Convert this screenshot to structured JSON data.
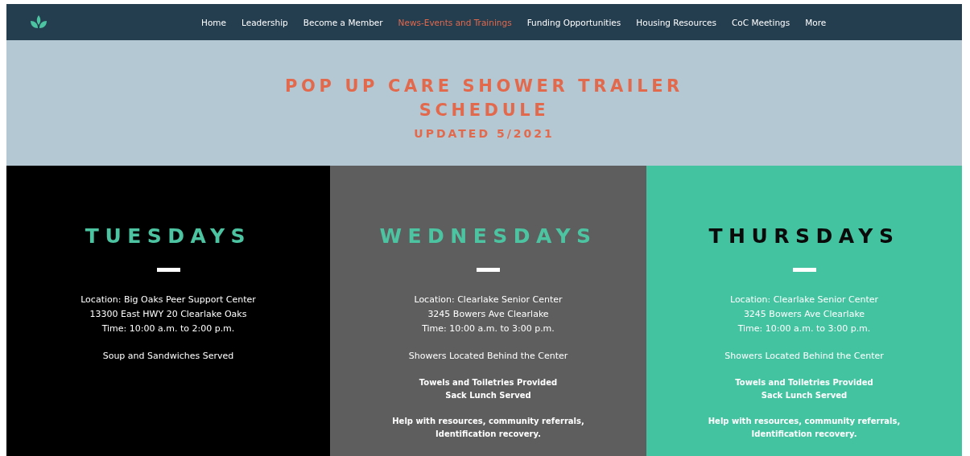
{
  "nav": {
    "items": [
      {
        "label": "Home",
        "selected": false
      },
      {
        "label": "Leadership",
        "selected": false
      },
      {
        "label": "Become a Member",
        "selected": false
      },
      {
        "label": "News-Events and Trainings",
        "selected": true
      },
      {
        "label": "Funding Opportunities",
        "selected": false
      },
      {
        "label": "Housing Resources",
        "selected": false
      },
      {
        "label": "CoC Meetings",
        "selected": false
      },
      {
        "label": "More",
        "selected": false
      }
    ]
  },
  "banner": {
    "title": "POP UP CARE SHOWER TRAILER SCHEDULE",
    "subtitle": "UPDATED 5/2021"
  },
  "columns": [
    {
      "kind": "dark",
      "day": "TUESDAYS",
      "paragraphs": [
        {
          "kind": "plain",
          "lines": [
            "Location: Big Oaks Peer Support Center",
            "13300 East HWY 20 Clearlake Oaks",
            "Time: 10:00 a.m. to 2:00 p.m."
          ]
        },
        {
          "kind": "plain",
          "lines": [
            "Soup and Sandwiches Served"
          ]
        }
      ]
    },
    {
      "kind": "gray",
      "day": "WEDNESDAYS",
      "paragraphs": [
        {
          "kind": "plain",
          "lines": [
            "Location: Clearlake Senior Center",
            "3245 Bowers Ave Clearlake",
            "Time: 10:00 a.m. to 3:00 p.m."
          ]
        },
        {
          "kind": "plain",
          "lines": [
            "Showers Located Behind the Center"
          ]
        },
        {
          "kind": "note",
          "lines": [
            "Towels and Toiletries Provided",
            "Sack Lunch Served"
          ]
        },
        {
          "kind": "note",
          "lines": [
            "Help with resources, community referrals,",
            "Identification recovery."
          ]
        }
      ]
    },
    {
      "kind": "teal",
      "day": "THURSDAYS",
      "paragraphs": [
        {
          "kind": "plain",
          "lines": [
            "Location: Clearlake Senior Center",
            "3245 Bowers Ave Clearlake",
            "Time: 10:00 a.m. to 3:00 p.m."
          ]
        },
        {
          "kind": "plain",
          "lines": [
            "Showers Located Behind the Center"
          ]
        },
        {
          "kind": "note",
          "lines": [
            "Towels and Toiletries Provided",
            "Sack Lunch Served"
          ]
        },
        {
          "kind": "note",
          "lines": [
            "Help with resources, community referrals,",
            "Identification recovery."
          ]
        }
      ]
    }
  ]
}
